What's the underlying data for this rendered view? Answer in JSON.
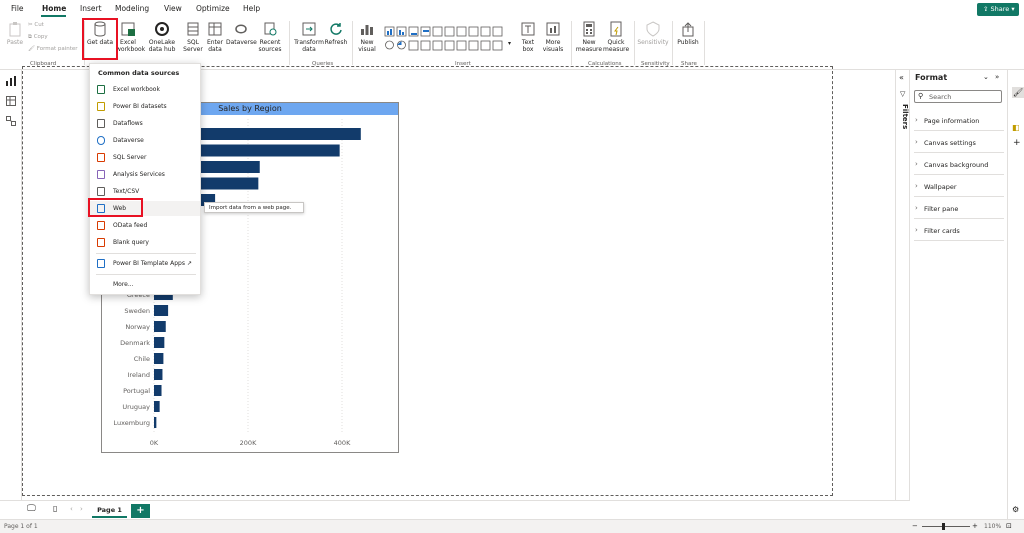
{
  "menubar": {
    "items": [
      "File",
      "Home",
      "Insert",
      "Modeling",
      "View",
      "Optimize",
      "Help"
    ],
    "active": "Home",
    "share_label": "Share"
  },
  "ribbon": {
    "clipboard": {
      "paste_label": "Paste",
      "cut_label": "Cut",
      "copy_label": "Copy",
      "format_painter_label": "Format painter",
      "group_label": "Clipboard"
    },
    "data": {
      "get_data_label": "Get data",
      "excel_label": "Excel workbook",
      "onelake_label": "OneLake data hub",
      "sql_label": "SQL Server",
      "enter_label": "Enter data",
      "dataverse_label": "Dataverse",
      "recent_label": "Recent sources"
    },
    "queries": {
      "transform_label": "Transform data",
      "refresh_label": "Refresh",
      "group_label": "Queries"
    },
    "insert": {
      "new_visual_label": "New visual",
      "text_box_label": "Text box",
      "more_visuals_label": "More visuals",
      "group_label": "Insert"
    },
    "calculations": {
      "new_measure_label": "New measure",
      "quick_measure_label": "Quick measure",
      "group_label": "Calculations"
    },
    "sensitivity": {
      "label": "Sensitivity",
      "group_label": "Sensitivity"
    },
    "share": {
      "publish_label": "Publish",
      "group_label": "Share"
    }
  },
  "dropdown": {
    "title": "Common data sources",
    "items": [
      "Excel workbook",
      "Power BI datasets",
      "Dataflows",
      "Dataverse",
      "SQL Server",
      "Analysis Services",
      "Text/CSV",
      "Web",
      "OData feed",
      "Blank query",
      "Power BI Template Apps",
      "More..."
    ],
    "tooltip": "Import data from a web page."
  },
  "chart_data": {
    "type": "bar",
    "orientation": "horizontal",
    "title": "Sales by Region",
    "visible_categories": [
      "Greece",
      "Sweden",
      "Norway",
      "Denmark",
      "Chile",
      "Ireland",
      "Portugal",
      "Uruguay",
      "Luxemburg"
    ],
    "visible_values": [
      40000,
      30000,
      25000,
      22000,
      20000,
      18000,
      16000,
      12000,
      5000
    ],
    "hidden_top_values": [
      440000,
      395000,
      225000,
      222000,
      130000
    ],
    "x_ticks": [
      "0K",
      "200K",
      "400K"
    ],
    "xlim": [
      0,
      500000
    ],
    "bar_color": "#123b6b"
  },
  "filters": {
    "label": "Filters"
  },
  "format_pane": {
    "title": "Format",
    "search_placeholder": "Search",
    "sections": [
      "Page information",
      "Canvas settings",
      "Canvas background",
      "Wallpaper",
      "Filter pane",
      "Filter cards"
    ]
  },
  "tabbar": {
    "page_tab": "Page 1",
    "add_label": "+"
  },
  "statusbar": {
    "page_info": "Page 1 of 1",
    "zoom": "110%"
  },
  "colors": {
    "accent": "#117865",
    "highlight": "#e81123",
    "bar": "#123b6b",
    "title_bg": "#6ea7f0"
  }
}
